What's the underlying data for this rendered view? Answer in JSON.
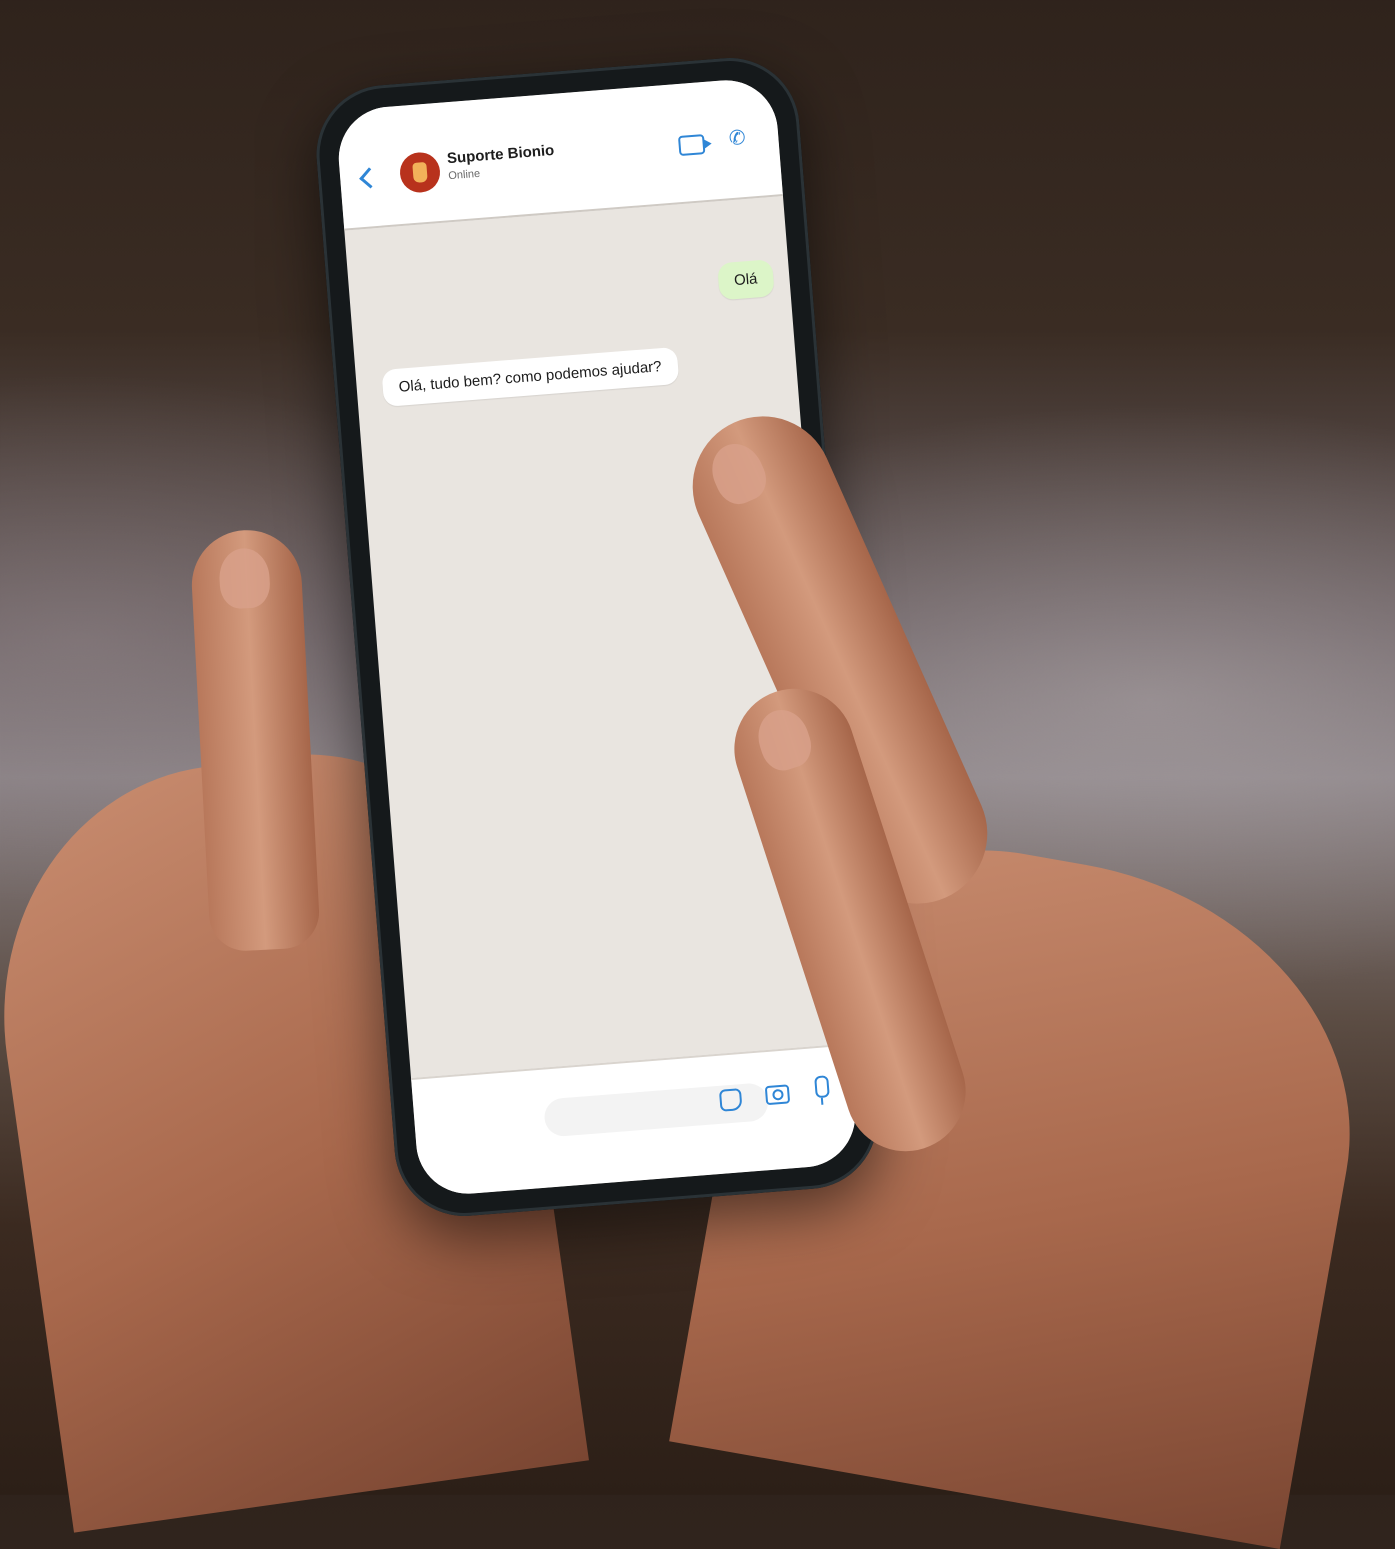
{
  "chat": {
    "contact_name": "Suporte Bionio",
    "contact_status": "Online",
    "messages": [
      {
        "direction": "outgoing",
        "text": "Olá"
      },
      {
        "direction": "incoming",
        "text": "Olá, tudo bem? como podemos ajudar?"
      }
    ],
    "input_placeholder": ""
  },
  "icons": {
    "back": "chevron-left-icon",
    "video": "video-call-icon",
    "call": "phone-icon",
    "sticker": "sticker-icon",
    "camera": "camera-icon",
    "mic": "microphone-icon"
  },
  "colors": {
    "accent": "#2f86d6",
    "outgoing_bubble": "#dcf5c8",
    "incoming_bubble": "#ffffff",
    "chat_background": "#e9e5e0",
    "avatar": "#b8321c"
  }
}
